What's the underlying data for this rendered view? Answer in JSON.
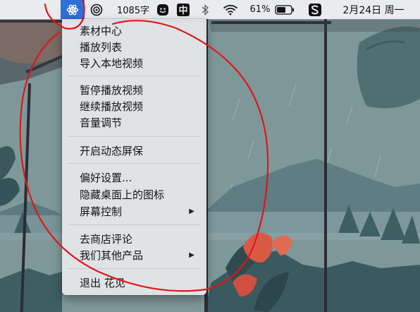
{
  "menubar": {
    "app_icon": "atom-icon",
    "status_icon": "record-icon",
    "word_count": "1085字",
    "emoji_icon": "smiley-icon",
    "input_method": "中",
    "bluetooth_icon": "bluetooth-icon",
    "wifi_icon": "wifi-icon",
    "battery_percent": "61%",
    "battery_icon": "battery-icon",
    "sogou_icon": "s-logo-icon",
    "date": "2月24日 周一"
  },
  "menu": {
    "groups": [
      [
        "素材中心",
        "播放列表",
        "导入本地视频"
      ],
      [
        "暂停播放视频",
        "继续播放视频",
        "音量调节"
      ],
      [
        "开启动态屏保"
      ],
      [
        "偏好设置...",
        "隐藏桌面上的图标",
        "屏幕控制"
      ],
      [
        "去商店评论",
        "我们其他产品"
      ],
      [
        "退出 花见"
      ]
    ],
    "submenu_arrow": "▶"
  },
  "colors": {
    "annotation": "#e0161b",
    "selection_blue": "#2f6fd8"
  }
}
